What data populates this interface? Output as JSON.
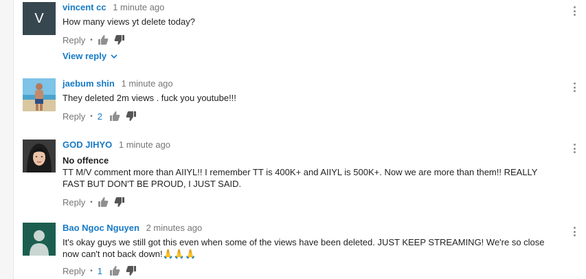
{
  "comments": [
    {
      "author": "vincent cc",
      "time": "1 minute ago",
      "avatar_letter": "V",
      "text": "How many views yt delete today?",
      "reply_label": "Reply",
      "like_count": "",
      "view_replies": "View reply"
    },
    {
      "author": "jaebum shin",
      "time": "1 minute ago",
      "text": "They deleted 2m views . fuck you youtube!!!",
      "reply_label": "Reply",
      "like_count": "2"
    },
    {
      "author": "GOD JIHYO",
      "time": "1 minute ago",
      "text_bold": "No offence",
      "text": "TT M/V comment more than AIIYL!! I remember TT is 400K+ and AIIYL is 500K+. Now we are more than them!! REALLY FAST BUT DON'T BE PROUD, I JUST SAID.",
      "reply_label": "Reply",
      "like_count": ""
    },
    {
      "author": "Bao Ngoc Nguyen",
      "time": "2 minutes ago",
      "text": "It's okay guys we still got this even when some of the views have been deleted. JUST KEEP STREAMING! We're so close now can't not back down!🙏🙏🙏",
      "reply_label": "Reply",
      "like_count": "1"
    }
  ],
  "colors": {
    "link": "#167ac6",
    "meta": "#767676",
    "avatar_default": "#37474f"
  }
}
